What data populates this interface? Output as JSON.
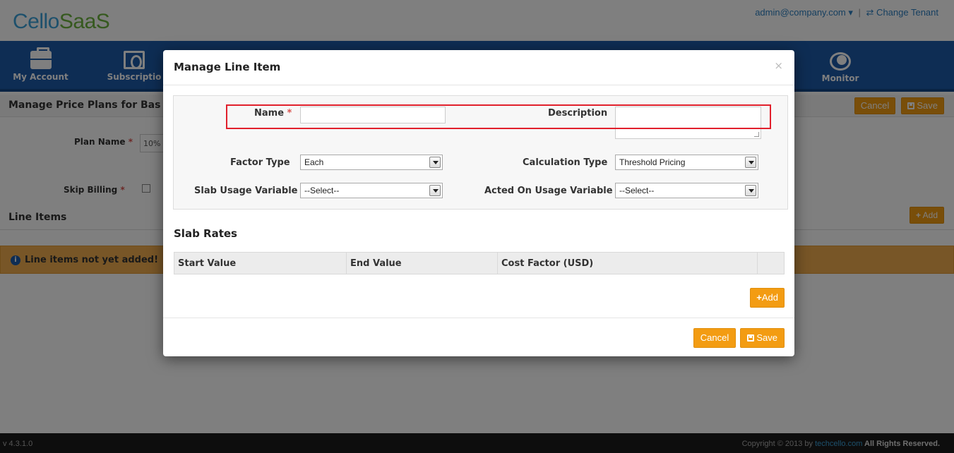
{
  "app": {
    "logo_cello": "Cello",
    "logo_saas": "SaaS",
    "user_menu": "admin@company.com ▾",
    "separator": "|",
    "change_tenant": "⇄ Change Tenant"
  },
  "nav": {
    "items": [
      {
        "label": "My Account",
        "icon": "briefcase-icon"
      },
      {
        "label": "Subscriptio",
        "icon": "money-icon"
      },
      {
        "label": "Monitor",
        "icon": "eye-icon"
      }
    ]
  },
  "page": {
    "title": "Manage Price Plans for Bas",
    "cancel_label": "Cancel",
    "save_label": "Save",
    "plan_name_label": "Plan Name",
    "plan_name_value": "10%",
    "skip_billing_label": "Skip Billing",
    "required_marker": "*",
    "line_items_title": "Line Items",
    "add_label": "Add",
    "alert_text": "Line items not yet added!"
  },
  "footer": {
    "version": "v 4.3.1.0",
    "copyright_prefix": "Copyright © 2013 by ",
    "copyright_link": "techcello.com",
    "copyright_suffix": " All Rights Reserved."
  },
  "modal": {
    "title": "Manage Line Item",
    "close": "×",
    "fields": {
      "name_label": "Name",
      "name_value": "",
      "description_label": "Description",
      "description_value": "",
      "factor_type_label": "Factor Type",
      "factor_type_value": "Each",
      "calculation_type_label": "Calculation Type",
      "calculation_type_value": "Threshold Pricing",
      "slab_usage_label": "Slab Usage Variable",
      "slab_usage_value": "--Select--",
      "acted_on_label": "Acted On Usage Variable",
      "acted_on_value": "--Select--",
      "required_marker": "*"
    },
    "slab_rates": {
      "title": "Slab Rates",
      "columns": [
        "Start Value",
        "End Value",
        "Cost Factor (USD)"
      ],
      "add_label": "Add"
    },
    "cancel_label": "Cancel",
    "save_label": "Save"
  },
  "colors": {
    "nav_blue": "#1d5aa8",
    "accent_orange": "#f39c12",
    "highlight_red": "#e1202c"
  }
}
